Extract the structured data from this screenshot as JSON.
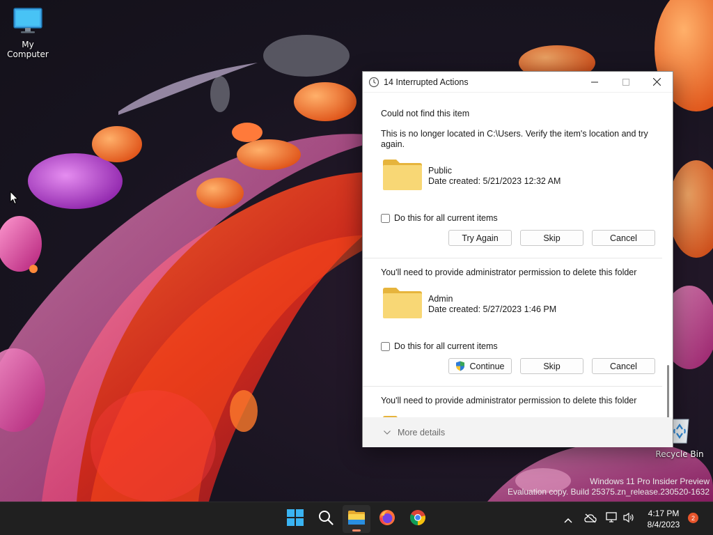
{
  "desktop": {
    "icons": [
      {
        "label": "My Computer"
      },
      {
        "label": "Recycle Bin"
      }
    ],
    "watermark": {
      "line1": "Windows 11 Pro Insider Preview",
      "line2": "Evaluation copy. Build 25375.zn_release.230520-1632"
    }
  },
  "dialog": {
    "title": "14 Interrupted Actions",
    "items": [
      {
        "heading": "Could not find this item",
        "message": "This is no longer located in C:\\Users. Verify the item's location and try again.",
        "file_name": "Public",
        "file_date": "Date created: 5/21/2023 12:32 AM",
        "checkbox_label": "Do this for all current items",
        "checked": false,
        "buttons": [
          "Try Again",
          "Skip",
          "Cancel"
        ]
      },
      {
        "heading": "You'll need to provide administrator permission to delete this folder",
        "file_name": "Admin",
        "file_date": "Date created: 5/27/2023 1:46 PM",
        "checkbox_label": "Do this for all current items",
        "checked": false,
        "buttons": [
          "Continue",
          "Skip",
          "Cancel"
        ]
      },
      {
        "heading": "You'll need to provide administrator permission to delete this folder"
      }
    ],
    "footer_label": "More details"
  },
  "taskbar": {
    "apps": [
      "start-icon",
      "search-icon",
      "file-explorer-icon",
      "firefox-icon",
      "chrome-icon"
    ],
    "active_app": "file-explorer-icon",
    "clock": {
      "time": "4:17 PM",
      "date": "8/4/2023"
    },
    "notification_count": "2"
  },
  "colors": {
    "accent": "#0067c0",
    "folder": "#f8d775",
    "taskbar": "#202020",
    "badge": "#e8552c"
  }
}
